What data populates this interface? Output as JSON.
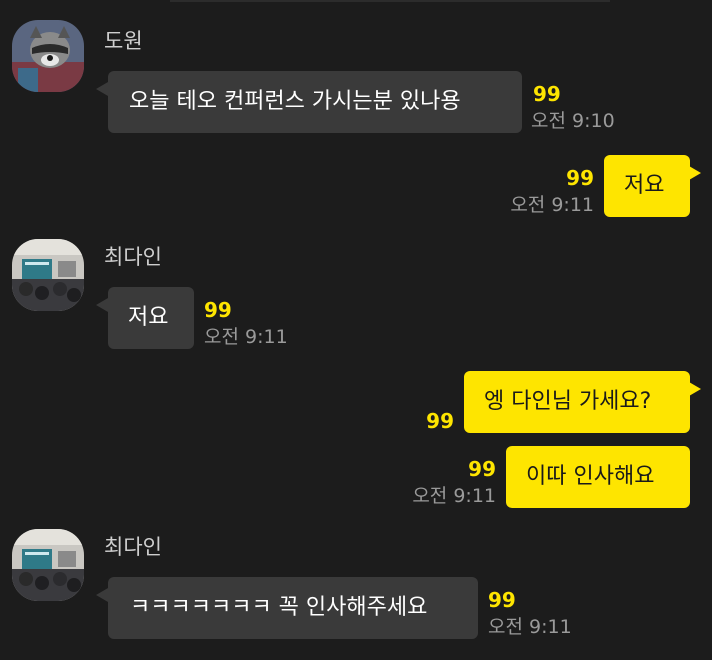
{
  "messages": [
    {
      "sender": "도원",
      "text": "오늘 테오 컨퍼런스 가시는분 있나용",
      "unread": "99",
      "time": "오전 9:10"
    },
    {
      "sender": "me",
      "text": "저요",
      "unread": "99",
      "time": "오전 9:11"
    },
    {
      "sender": "최다인",
      "text": "저요",
      "unread": "99",
      "time": "오전 9:11"
    },
    {
      "sender": "me",
      "text": "엥 다인님 가세요?",
      "unread": "99"
    },
    {
      "sender": "me",
      "text": "이따 인사해요",
      "unread": "99",
      "time": "오전 9:11"
    },
    {
      "sender": "최다인",
      "text": "ㅋㅋㅋㅋㅋㅋㅋ 꼭 인사해주세요",
      "unread": "99",
      "time": "오전 9:11"
    }
  ],
  "colors": {
    "background": "#1c1c1c",
    "incoming_bubble": "#3a3a3a",
    "outgoing_bubble": "#fee500",
    "unread_count": "#fee500",
    "timestamp": "#9a9a9a"
  },
  "icons": {
    "avatar_1": "raccoon-profile-photo",
    "avatar_2": "conference-room-profile-photo"
  }
}
